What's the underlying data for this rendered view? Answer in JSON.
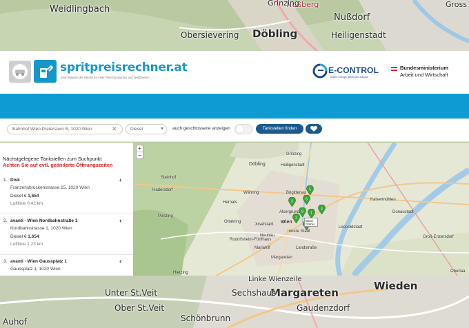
{
  "background_map": {
    "labels": [
      "Weidlingbach",
      "Nußdorf",
      "Obersievering",
      "Döbling",
      "Heiligenstadt",
      "Unter St.Veit",
      "Margareten",
      "Wieden",
      "Ober St.Veit",
      "Gaudenzdorf",
      "Schönbrunn",
      "Nußberg",
      "Grinzing",
      "Gross",
      "Auhof",
      "Sechshaus",
      "Linke Wienzeile"
    ]
  },
  "header": {
    "brand_name": "spritpreisrechner.at",
    "brand_sub": "Eine Initiative des BMAW für mehr Preistransparenz und Wettbewerb",
    "econtrol_name": "E-CONTROL",
    "econtrol_sub": "Unsere Energie gehört der Zukunft",
    "ministry_line1": "Bundesministerium",
    "ministry_line2": "Arbeit und Wirtschaft"
  },
  "search": {
    "location_value": "Bahnhof Wien Praterstern B, 1020 Wien",
    "fuel_value": "Diesel",
    "closed_label": "auch geschlossene anzeigen",
    "closed_toggle_on": false,
    "find_button": "Tankstellen finden"
  },
  "panel": {
    "title": "Nächstgelegene Tankstellen zum Suchpunkt",
    "warning": "Achten Sie auf evtl. geänderte Öffnungszeiten",
    "results": [
      {
        "index": "1.",
        "name": "Disk",
        "address": "Franzensbrückenstrasse 15, 1020 Wien",
        "price_label": "Diesel €",
        "price": "1,654",
        "distance": "Luftlinie 0,42 km"
      },
      {
        "index": "2.",
        "name": "avanti - Wien Nordbahnstraße 1",
        "address": "Nordbahnstrasse 1, 1020 Wien",
        "price_label": "Diesel €",
        "price": "1,654",
        "distance": "Luftlinie 1,23 km"
      },
      {
        "index": "3.",
        "name": "avanti - Wien Gaussplatz 1",
        "address": "Gaussplatz 1, 1020 Wien",
        "price_label": "",
        "price": "",
        "distance": ""
      }
    ]
  },
  "map": {
    "labels": [
      "Döbling",
      "Währing",
      "Hernals",
      "Ottakring",
      "Josefstadt",
      "Alsergrund",
      "Brigittenau",
      "Wien",
      "Innere Stadt",
      "Landstraße",
      "Leopoldstadt",
      "Donaustadt",
      "Neubau",
      "Rudolfsheim-Fünfhaus",
      "Margareten",
      "Penzing",
      "Hietzing",
      "Groß-Enzersdorf",
      "Grinzing",
      "Heiligenstadt",
      "Hadersdorf",
      "Mariahilf",
      "Oberlaa",
      "Kaisermühlen",
      "Steinhof"
    ],
    "popup": "Baed GmbH",
    "pins": [
      "5",
      "6",
      "3",
      "8",
      "1",
      "4",
      "2",
      "7"
    ],
    "zoom_in": "+",
    "zoom_out": "−"
  },
  "colors": {
    "brand_blue": "#1598c9",
    "bar_blue": "#0e9bd3",
    "button_navy": "#1a5a8f",
    "warning_red": "#e02020",
    "pin_green": "#3aa33a"
  }
}
